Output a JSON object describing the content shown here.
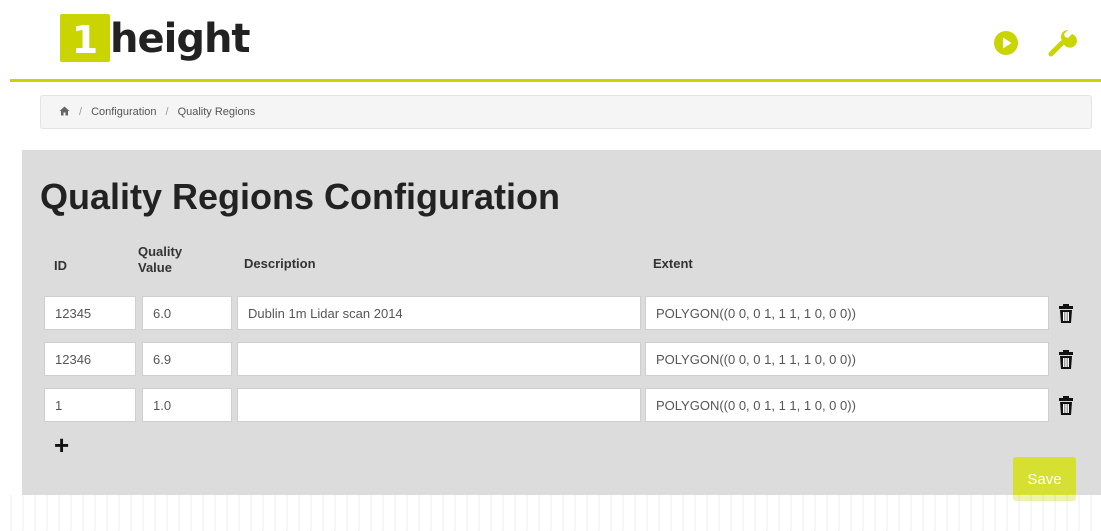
{
  "app": {
    "logo_number": "1",
    "logo_text": "height"
  },
  "header": {
    "icons": [
      "play-circle-icon",
      "wrench-icon"
    ],
    "accent_color": "#c9d400"
  },
  "breadcrumb": {
    "home_icon": "home-icon",
    "items": [
      "Configuration",
      "Quality Regions"
    ]
  },
  "page": {
    "title": "Quality Regions Configuration"
  },
  "table": {
    "headers": {
      "id": "ID",
      "quality_line1": "Quality",
      "quality_line2": "Value",
      "description": "Description",
      "extent": "Extent"
    },
    "rows": [
      {
        "id": "12345",
        "quality": "6.0",
        "description": "Dublin 1m Lidar scan 2014",
        "extent": "POLYGON((0 0, 0 1, 1 1, 1 0, 0 0))"
      },
      {
        "id": "12346",
        "quality": "6.9",
        "description": "",
        "extent": "POLYGON((0 0, 0 1, 1 1, 1 0, 0 0))"
      },
      {
        "id": "1",
        "quality": "1.0",
        "description": "",
        "extent": "POLYGON((0 0, 0 1, 1 1, 1 0, 0 0))"
      }
    ]
  },
  "actions": {
    "add_label": "+",
    "save_label": "Save"
  }
}
